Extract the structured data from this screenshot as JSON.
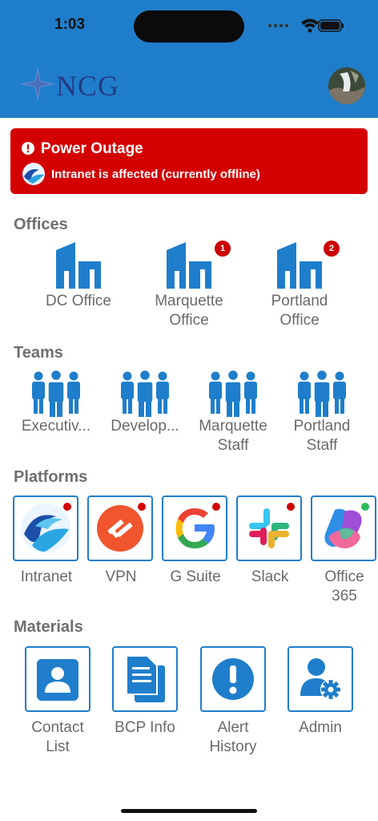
{
  "status_bar": {
    "time": "1:03"
  },
  "header": {
    "logo_text": "NCG",
    "brand_color": "#1f7ecb",
    "avatar": "user-avatar-photo"
  },
  "alert": {
    "title": "Power Outage",
    "message": "Intranet is affected (currently offline)",
    "color": "#d40000"
  },
  "offices": {
    "title": "Offices",
    "items": [
      {
        "label_line1": "DC Office",
        "label_line2": "",
        "badge": ""
      },
      {
        "label_line1": "Marquette",
        "label_line2": "Office",
        "badge": "1"
      },
      {
        "label_line1": "Portland",
        "label_line2": "Office",
        "badge": "2"
      }
    ]
  },
  "teams": {
    "title": "Teams",
    "items": [
      {
        "label_line1": "Executiv...",
        "label_line2": ""
      },
      {
        "label_line1": "Develop...",
        "label_line2": ""
      },
      {
        "label_line1": "Marquette",
        "label_line2": "Staff"
      },
      {
        "label_line1": "Portland",
        "label_line2": "Staff"
      }
    ]
  },
  "platforms": {
    "title": "Platforms",
    "items": [
      {
        "label_line1": "Intranet",
        "label_line2": "",
        "icon": "intranet-wave-icon",
        "status": "red"
      },
      {
        "label_line1": "VPN",
        "label_line2": "",
        "icon": "vpn-icon",
        "status": "red"
      },
      {
        "label_line1": "G Suite",
        "label_line2": "",
        "icon": "google-icon",
        "status": "red"
      },
      {
        "label_line1": "Slack",
        "label_line2": "",
        "icon": "slack-icon",
        "status": "red"
      },
      {
        "label_line1": "Office",
        "label_line2": "365",
        "icon": "office-365-icon",
        "status": "green"
      }
    ]
  },
  "materials": {
    "title": "Materials",
    "items": [
      {
        "label_line1": "Contact",
        "label_line2": "List",
        "icon": "contact-list-icon"
      },
      {
        "label_line1": "BCP Info",
        "label_line2": "",
        "icon": "documents-icon"
      },
      {
        "label_line1": "Alert",
        "label_line2": "History",
        "icon": "alert-history-icon"
      },
      {
        "label_line1": "Admin",
        "label_line2": "",
        "icon": "admin-gear-icon"
      }
    ]
  }
}
